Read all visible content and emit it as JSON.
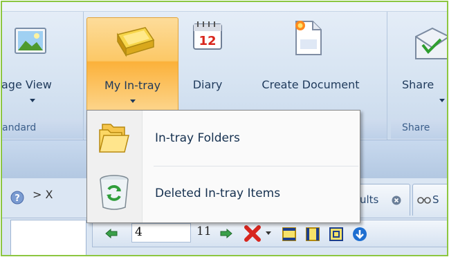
{
  "ribbon": {
    "groups": [
      {
        "label": "andard"
      },
      {
        "label": ""
      },
      {
        "label": "Share"
      }
    ],
    "buttons": {
      "page_view": "age View",
      "my_intray": "My In-tray",
      "diary": "Diary",
      "diary_day": "12",
      "create_document": "Create Document",
      "share": "Share"
    }
  },
  "menu": {
    "items": [
      {
        "label": "In-tray Folders",
        "icon": "folders-icon"
      },
      {
        "label": "Deleted In-tray Items",
        "icon": "recycle-bin-icon"
      }
    ]
  },
  "tabs": {
    "nav": "> X",
    "results_tab": "ults",
    "search_tab": "S"
  },
  "toolbar": {
    "page_number": "4",
    "page_total": "11"
  },
  "colors": {
    "frame": "#8cc63f",
    "active_button": "#fcc866",
    "ribbon": "#d7e4f2"
  }
}
